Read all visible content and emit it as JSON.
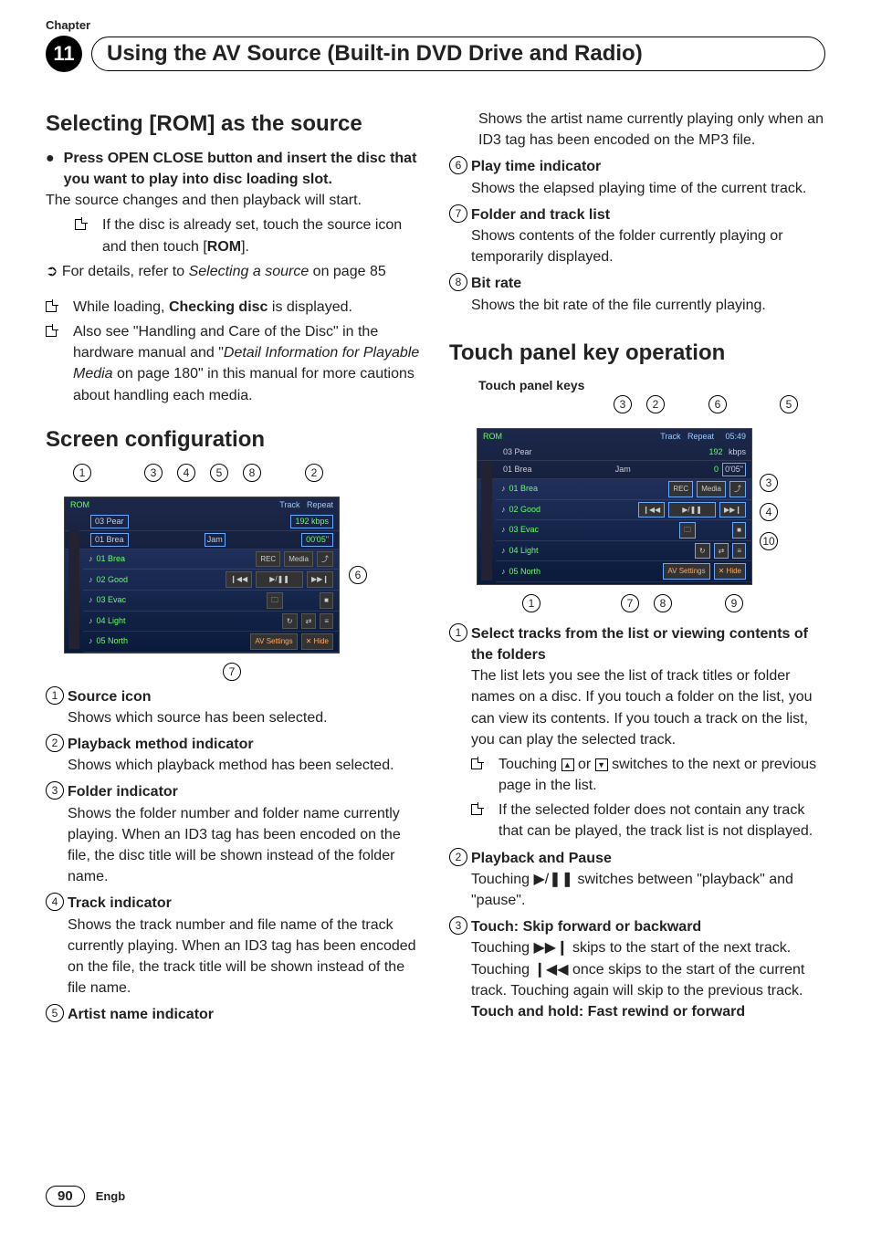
{
  "chapter_label": "Chapter",
  "chapter_number": "11",
  "chapter_title": "Using the AV Source (Built-in DVD Drive and Radio)",
  "col1": {
    "h1": "Selecting [ROM] as the source",
    "lead": "Press OPEN CLOSE button and insert the disc that you want to play into disc loading slot.",
    "p1": "The source changes and then playback will start.",
    "sq1a": "If the disc is already set, touch the source icon and then touch [",
    "sq1b": "ROM",
    "sq1c": "].",
    "arrow1a": "For details, refer to ",
    "arrow1b": "Selecting a source",
    "arrow1c": " on page 85",
    "sq2a": "While loading, ",
    "sq2b": "Checking disc",
    "sq2c": " is displayed.",
    "sq3a": "Also see \"Handling and Care of the Disc\" in the hardware manual and \"",
    "sq3b": "Detail Information for Playable Media",
    "sq3c": " on page 180\" in this manual for more cautions about handling each media.",
    "h2": "Screen configuration",
    "screenshot_tracks": [
      "01 Brea",
      "02 Good",
      "03 Evac",
      "04 Light",
      "05 North"
    ],
    "screenshot_top1": "03 Pear",
    "screenshot_top2": "01 Brea",
    "screenshot_label_rom": "ROM",
    "screenshot_jam": "Jam",
    "screenshot_kbps": "192 kbps",
    "screenshot_time": "00'05\"",
    "screenshot_rec": "REC",
    "screenshot_media": "Media",
    "screenshot_av": "AV Settings",
    "screenshot_hide": "Hide",
    "callouts_top": [
      "1",
      "3",
      "4",
      "5",
      "8",
      "2"
    ],
    "callouts_bottom": [
      "7"
    ],
    "callout_right": "6",
    "defs": [
      {
        "n": "1",
        "title": "Source icon",
        "body": "Shows which source has been selected."
      },
      {
        "n": "2",
        "title": "Playback method indicator",
        "body": "Shows which playback method has been selected."
      },
      {
        "n": "3",
        "title": "Folder indicator",
        "body": "Shows the folder number and folder name currently playing. When an ID3 tag has been encoded on the file, the disc title will be shown instead of the folder name."
      },
      {
        "n": "4",
        "title": "Track indicator",
        "body": "Shows the track number and file name of the track currently playing. When an ID3 tag has been encoded on the file, the track title will be shown instead of the file name."
      },
      {
        "n": "5",
        "title": "Artist name indicator",
        "body": ""
      }
    ]
  },
  "col2": {
    "p_cont": "Shows the artist name currently playing only when an ID3 tag has been encoded on the MP3 file.",
    "defs_top": [
      {
        "n": "6",
        "title": "Play time indicator",
        "body": "Shows the elapsed playing time of the current track."
      },
      {
        "n": "7",
        "title": "Folder and track list",
        "body": "Shows contents of the folder currently playing or temporarily displayed."
      },
      {
        "n": "8",
        "title": "Bit rate",
        "body": "Shows the bit rate of the file currently playing."
      }
    ],
    "h1": "Touch panel key operation",
    "sub": "Touch panel keys",
    "callouts_top": [
      "3",
      "2",
      "6",
      "5"
    ],
    "callouts_right": [
      "3",
      "4",
      "10"
    ],
    "callouts_bottom": [
      "1",
      "7",
      "8",
      "9"
    ],
    "defs": [
      {
        "n": "1",
        "title": "Select tracks from the list or viewing contents of the folders",
        "body": "The list lets you see the list of track titles or folder names on a disc. If you touch a folder on the list, you can view its contents. If you touch a track on the list, you can play the selected track.",
        "sub": [
          "Touching ▲ or ▼ switches to the next or previous page in the list.",
          "If the selected folder does not contain any track that can be played, the track list is not displayed."
        ]
      },
      {
        "n": "2",
        "title": "Playback and Pause",
        "body": "Touching ▶/❚❚ switches between \"playback\" and \"pause\"."
      },
      {
        "n": "3",
        "title": "Touch: Skip forward or backward",
        "body": "Touching ▶▶❙ skips to the start of the next track. Touching ❙◀◀ once skips to the start of the current track. Touching again will skip to the previous track.",
        "extra": "Touch and hold: Fast rewind or forward"
      }
    ]
  },
  "footer": {
    "page": "90",
    "lang": "Engb"
  }
}
